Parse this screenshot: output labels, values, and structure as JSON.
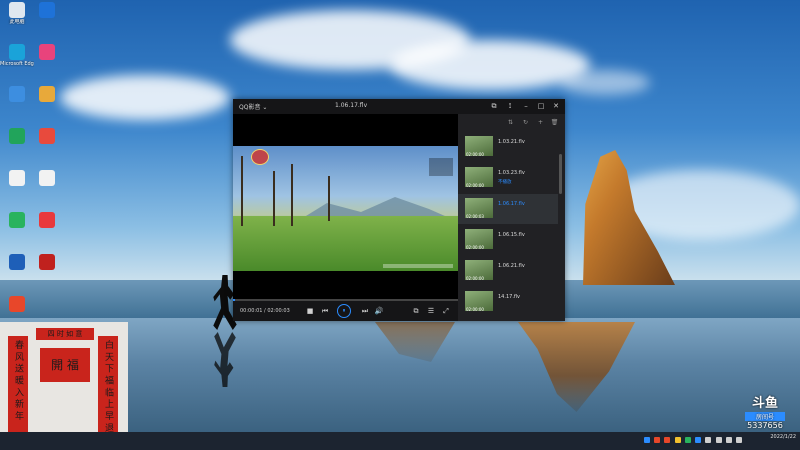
{
  "desktop": {
    "icons": [
      {
        "label": "此电脑",
        "color": "#dfe7ef"
      },
      {
        "label": "",
        "color": "#1e72d8"
      },
      {
        "label": "Microsoft Edge",
        "color": "#1aa3d9"
      },
      {
        "label": "",
        "color": "#e8437c"
      },
      {
        "label": "",
        "color": "#3d8ee0"
      },
      {
        "label": "",
        "color": "#e8a93a"
      },
      {
        "label": "",
        "color": "#21a45b"
      },
      {
        "label": "",
        "color": "#e84a3d"
      },
      {
        "label": "",
        "color": "#f2f2f2"
      },
      {
        "label": "",
        "color": "#f2f2f2"
      },
      {
        "label": "",
        "color": "#29b35e"
      },
      {
        "label": "",
        "color": "#e8393d"
      },
      {
        "label": "",
        "color": "#1e5fb8"
      },
      {
        "label": "",
        "color": "#c0211e"
      },
      {
        "label": "",
        "color": "#e8472a"
      }
    ]
  },
  "player": {
    "app_name": "QQ影音 ⌄",
    "file_title": "1.06.17.flv",
    "time_display": "00:00:01 / 02:00:03",
    "progress": 0.01,
    "controls": {
      "stop": "■",
      "prev": "⏮",
      "play": "⏸",
      "next": "⏭",
      "volume": "🔊",
      "screenshot": "⧉",
      "settings": "☰",
      "fullscreen": "⤢"
    },
    "window_buttons": {
      "min": "–",
      "max": "□",
      "close": "✕"
    },
    "playlist": [
      {
        "name": "1.03.21.flv",
        "duration": "02:00:00",
        "sub": "",
        "active": false
      },
      {
        "name": "1.03.23.flv",
        "duration": "02:00:00",
        "sub": "不播放",
        "active": false
      },
      {
        "name": "1.06.17.flv",
        "duration": "02:00:03",
        "sub": "",
        "active": true
      },
      {
        "name": "1.06.15.flv",
        "duration": "02:00:00",
        "sub": "",
        "active": false
      },
      {
        "name": "1.06.21.flv",
        "duration": "02:00:00",
        "sub": "",
        "active": false
      },
      {
        "name": "14.17.flv",
        "duration": "02:00:00",
        "sub": "",
        "active": false
      }
    ]
  },
  "couplet": {
    "horizontal": "四 时 如 意",
    "center": "開 福",
    "left": "春 风 送 暖 入 新 年",
    "right": "白 天 下 福 临 上 早 退"
  },
  "watermark": {
    "logo": "斗鱼",
    "room_label": "房间号",
    "room_number": "5337656"
  },
  "taskbar": {
    "clock_time": "",
    "clock_date": "2022/1/22"
  }
}
